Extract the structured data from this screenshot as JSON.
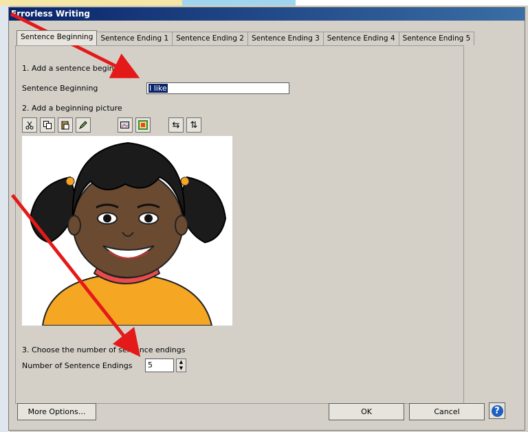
{
  "window": {
    "title": "Errorless Writing"
  },
  "tabs": [
    {
      "label": "Sentence Beginning",
      "active": true
    },
    {
      "label": "Sentence Ending 1"
    },
    {
      "label": "Sentence Ending 2"
    },
    {
      "label": "Sentence Ending 3"
    },
    {
      "label": "Sentence Ending 4"
    },
    {
      "label": "Sentence Ending 5"
    }
  ],
  "section1": {
    "heading": "1. Add a sentence beginning",
    "field_label": "Sentence Beginning",
    "field_value": "I like"
  },
  "section2": {
    "heading": "2. Add a beginning picture",
    "toolbar_icons": [
      "cut-icon",
      "copy-icon",
      "paste-icon",
      "edit-pencil-icon",
      "insert-picture-icon",
      "picture-frame-icon",
      "flip-horizontal-icon",
      "flip-vertical-icon"
    ],
    "picture_alt": "girl with pigtails"
  },
  "section3": {
    "heading": "3. Choose the number of sentence endings",
    "field_label": "Number of Sentence Endings",
    "field_value": "5"
  },
  "buttons": {
    "more_options": "More Options...",
    "ok": "OK",
    "cancel": "Cancel"
  },
  "colors": {
    "titlebar": "#0a246a",
    "annotation_arrow": "#e41a1a",
    "help_icon": "#1f5fbf"
  }
}
